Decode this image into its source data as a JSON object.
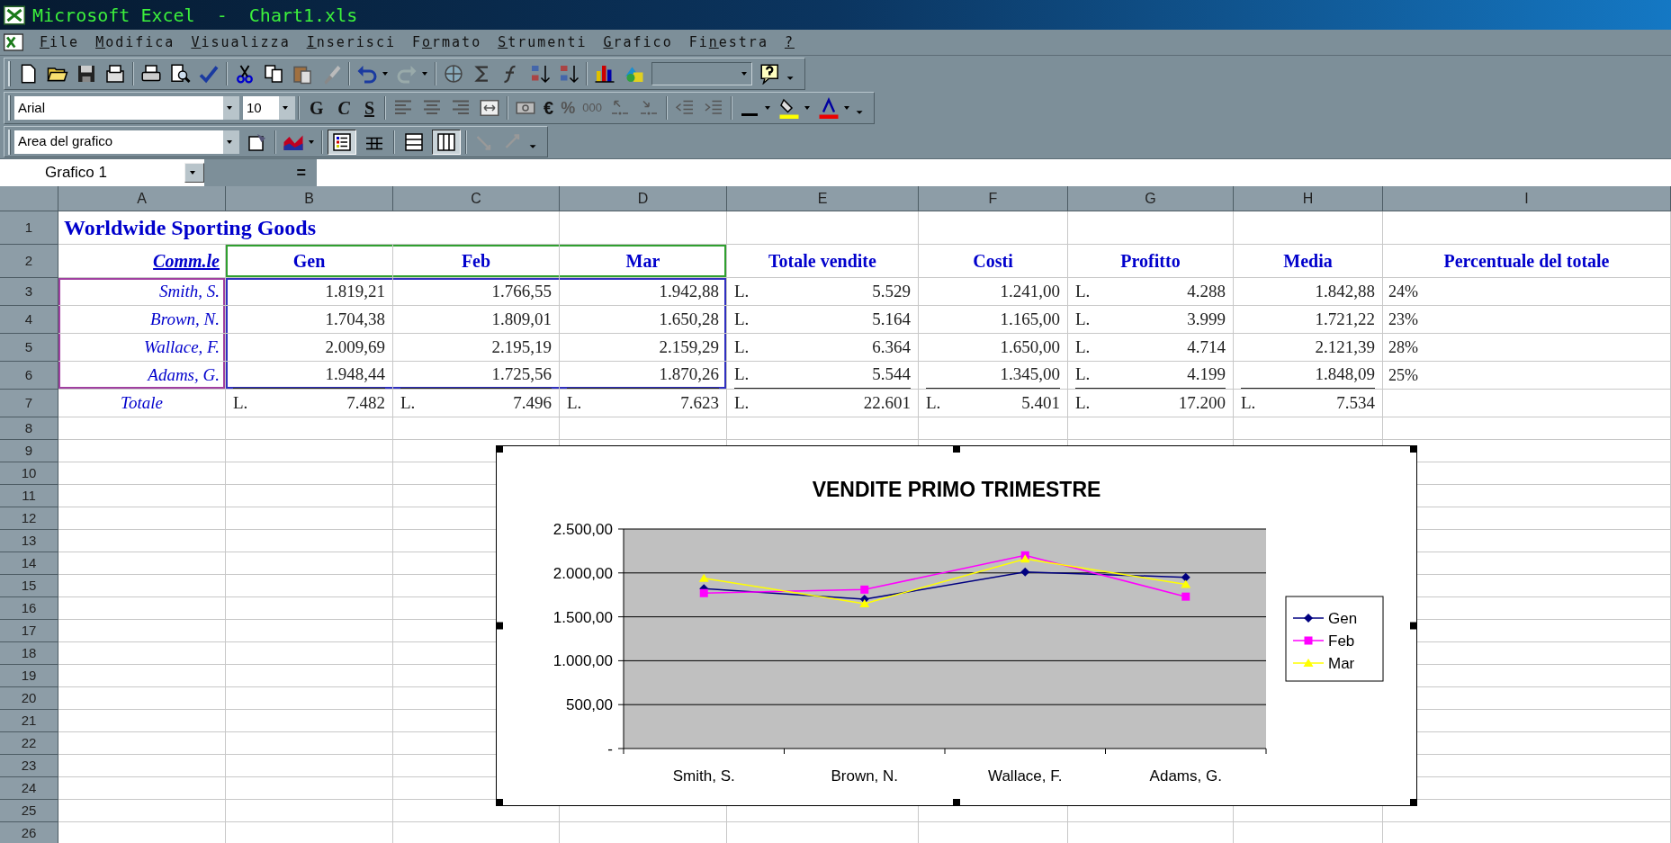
{
  "window": {
    "title": "Microsoft Excel  -  Chart1.xls"
  },
  "menu": [
    {
      "key": "F",
      "post": "ile"
    },
    {
      "key": "M",
      "post": "odifica"
    },
    {
      "key": "V",
      "post": "isualizza"
    },
    {
      "key": "I",
      "post": "nserisci"
    },
    {
      "pre": "F",
      "key": "o",
      "post": "rmato"
    },
    {
      "key": "S",
      "post": "trumenti"
    },
    {
      "key": "G",
      "post": "rafico"
    },
    {
      "pre": "Fi",
      "key": "n",
      "post": "estra"
    },
    {
      "key": "?"
    }
  ],
  "formatting": {
    "font": "Arial",
    "size": "10",
    "bold": "G",
    "italic": "C",
    "underline": "S",
    "euro": "€",
    "percent": "%",
    "thousands": "000"
  },
  "chart_toolbar": {
    "object": "Area del grafico",
    "legend_pressed": true,
    "data_table_pressed": false,
    "by_row_pressed": false,
    "by_column_pressed": true
  },
  "formula_bar": {
    "name_box": "Grafico 1",
    "equals": "="
  },
  "columns": [
    "A",
    "B",
    "C",
    "D",
    "E",
    "F",
    "G",
    "H",
    "I"
  ],
  "rows": [
    {
      "label": "1",
      "cells": [
        {
          "kind": "title",
          "text": "Worldwide Sporting Goods"
        },
        null,
        null,
        null,
        null,
        null,
        null
      ]
    },
    {
      "label": "2",
      "cells": [
        {
          "kind": "col-label",
          "text": "Comm.le"
        },
        {
          "kind": "header",
          "text": "Gen",
          "color": "#30a030"
        },
        {
          "kind": "header",
          "text": "Feb",
          "color": "#30a030"
        },
        {
          "kind": "header",
          "text": "Mar",
          "color": "#30a030"
        },
        {
          "kind": "header",
          "text": "Totale vendite"
        },
        {
          "kind": "header",
          "text": "Costi"
        },
        {
          "kind": "header",
          "text": "Profitto"
        },
        {
          "kind": "header",
          "text": "Media"
        },
        {
          "kind": "header",
          "text": "Percentuale del totale"
        }
      ]
    },
    {
      "label": "3",
      "cells": [
        {
          "kind": "name",
          "text": "Smith, S.",
          "color": "#a040a0"
        },
        {
          "kind": "num",
          "text": "1.819,21",
          "color": "#3030c0",
          "underlined": false
        },
        {
          "kind": "num",
          "text": "1.766,55",
          "color": "#3030c0",
          "underlined": false
        },
        {
          "kind": "num",
          "text": "1.942,88",
          "color": "#3030c0",
          "underlined": false
        },
        {
          "kind": "cur",
          "prefix": "L.",
          "text": "5.529",
          "underlined": false
        },
        {
          "kind": "num",
          "text": "1.241,00",
          "underlined": false
        },
        {
          "kind": "cur",
          "prefix": "L.",
          "text": "4.288",
          "underlined": false
        },
        {
          "kind": "num",
          "text": "1.842,88",
          "underlined": false
        },
        {
          "kind": "pct",
          "text": "24%"
        }
      ]
    },
    {
      "label": "4",
      "cells": [
        {
          "kind": "name",
          "text": "Brown, N.",
          "color": "#a040a0"
        },
        {
          "kind": "num",
          "text": "1.704,38",
          "color": "#3030c0",
          "underlined": false
        },
        {
          "kind": "num",
          "text": "1.809,01",
          "underlined": false
        },
        {
          "kind": "num",
          "text": "1.650,28",
          "color": "#3030c0",
          "underlined": false
        },
        {
          "kind": "cur",
          "prefix": "L.",
          "text": "5.164",
          "underlined": false
        },
        {
          "kind": "num",
          "text": "1.165,00",
          "underlined": false
        },
        {
          "kind": "cur",
          "prefix": "L.",
          "text": "3.999",
          "underlined": false
        },
        {
          "kind": "num",
          "text": "1.721,22",
          "underlined": false
        },
        {
          "kind": "pct",
          "text": "23%"
        }
      ]
    },
    {
      "label": "5",
      "cells": [
        {
          "kind": "name",
          "text": "Wallace, F.",
          "color": "#a040a0"
        },
        {
          "kind": "num",
          "text": "2.009,69",
          "color": "#3030c0",
          "underlined": false
        },
        {
          "kind": "num",
          "text": "2.195,19",
          "underlined": false
        },
        {
          "kind": "num",
          "text": "2.159,29",
          "color": "#3030c0",
          "underlined": false
        },
        {
          "kind": "cur",
          "prefix": "L.",
          "text": "6.364",
          "underlined": false
        },
        {
          "kind": "num",
          "text": "1.650,00",
          "underlined": false
        },
        {
          "kind": "cur",
          "prefix": "L.",
          "text": "4.714",
          "underlined": false
        },
        {
          "kind": "num",
          "text": "2.121,39",
          "underlined": false
        },
        {
          "kind": "pct",
          "text": "28%"
        }
      ]
    },
    {
      "label": "6",
      "cells": [
        {
          "kind": "name",
          "text": "Adams, G.",
          "color": "#a040a0"
        },
        {
          "kind": "num",
          "text": "1.948,44",
          "color": "#3030c0",
          "underlined": true
        },
        {
          "kind": "num",
          "text": "1.725,56",
          "color": "#3030c0",
          "underlined": true
        },
        {
          "kind": "num",
          "text": "1.870,26",
          "color": "#3030c0",
          "underlined": true
        },
        {
          "kind": "cur",
          "prefix": "L.",
          "text": "5.544",
          "underlined": true
        },
        {
          "kind": "num",
          "text": "1.345,00",
          "underlined": true
        },
        {
          "kind": "cur",
          "prefix": "L.",
          "text": "4.199",
          "underlined": true
        },
        {
          "kind": "num",
          "text": "1.848,09",
          "underlined": true
        },
        {
          "kind": "pct",
          "text": "25%"
        }
      ]
    },
    {
      "label": "7",
      "cells": [
        {
          "kind": "total-label",
          "text": "Totale"
        },
        {
          "kind": "cur",
          "prefix": "L.",
          "text": "7.482",
          "underlined": false
        },
        {
          "kind": "cur",
          "prefix": "L.",
          "text": "7.496",
          "underlined": false
        },
        {
          "kind": "cur",
          "prefix": "L.",
          "text": "7.623",
          "underlined": false
        },
        {
          "kind": "cur",
          "prefix": "L.",
          "text": "22.601",
          "underlined": false
        },
        {
          "kind": "cur",
          "prefix": "L.",
          "text": "5.401",
          "underlined": false
        },
        {
          "kind": "cur",
          "prefix": "L.",
          "text": "17.200",
          "underlined": false
        },
        {
          "kind": "cur",
          "prefix": "L.",
          "text": "7.534",
          "underlined": false
        },
        null
      ]
    },
    {
      "label": "8"
    },
    {
      "label": "9"
    },
    {
      "label": "10"
    },
    {
      "label": "11"
    },
    {
      "label": "12"
    },
    {
      "label": "13"
    },
    {
      "label": "14"
    },
    {
      "label": "15"
    },
    {
      "label": "16"
    },
    {
      "label": "17"
    },
    {
      "label": "18"
    },
    {
      "label": "19"
    },
    {
      "label": "20"
    },
    {
      "label": "21"
    },
    {
      "label": "22"
    },
    {
      "label": "23"
    },
    {
      "label": "24"
    },
    {
      "label": "25"
    },
    {
      "label": "26"
    }
  ],
  "chart": {
    "selected": true,
    "chart_data": {
      "type": "line",
      "title": "VENDITE PRIMO TRIMESTRE",
      "categories": [
        "Smith, S.",
        "Brown, N.",
        "Wallace, F.",
        "Adams, G."
      ],
      "series": [
        {
          "name": "Gen",
          "color": "#000080",
          "marker": "diamond",
          "values": [
            1820,
            1700,
            2010,
            1950
          ]
        },
        {
          "name": "Feb",
          "color": "#ff00ff",
          "marker": "square",
          "values": [
            1770,
            1810,
            2200,
            1730
          ]
        },
        {
          "name": "Mar",
          "color": "#ffff00",
          "marker": "triangle",
          "values": [
            1940,
            1650,
            2160,
            1870
          ]
        }
      ],
      "grid": true,
      "legend": true,
      "ylim": [
        0,
        2500
      ],
      "yticks": [
        {
          "value": 0,
          "label": "-"
        },
        {
          "value": 500,
          "label": "500,00"
        },
        {
          "value": 1000,
          "label": "1.000,00"
        },
        {
          "value": 1500,
          "label": "1.500,00"
        },
        {
          "value": 2000,
          "label": "2.000,00"
        },
        {
          "value": 2500,
          "label": "2.500,00"
        }
      ]
    }
  }
}
